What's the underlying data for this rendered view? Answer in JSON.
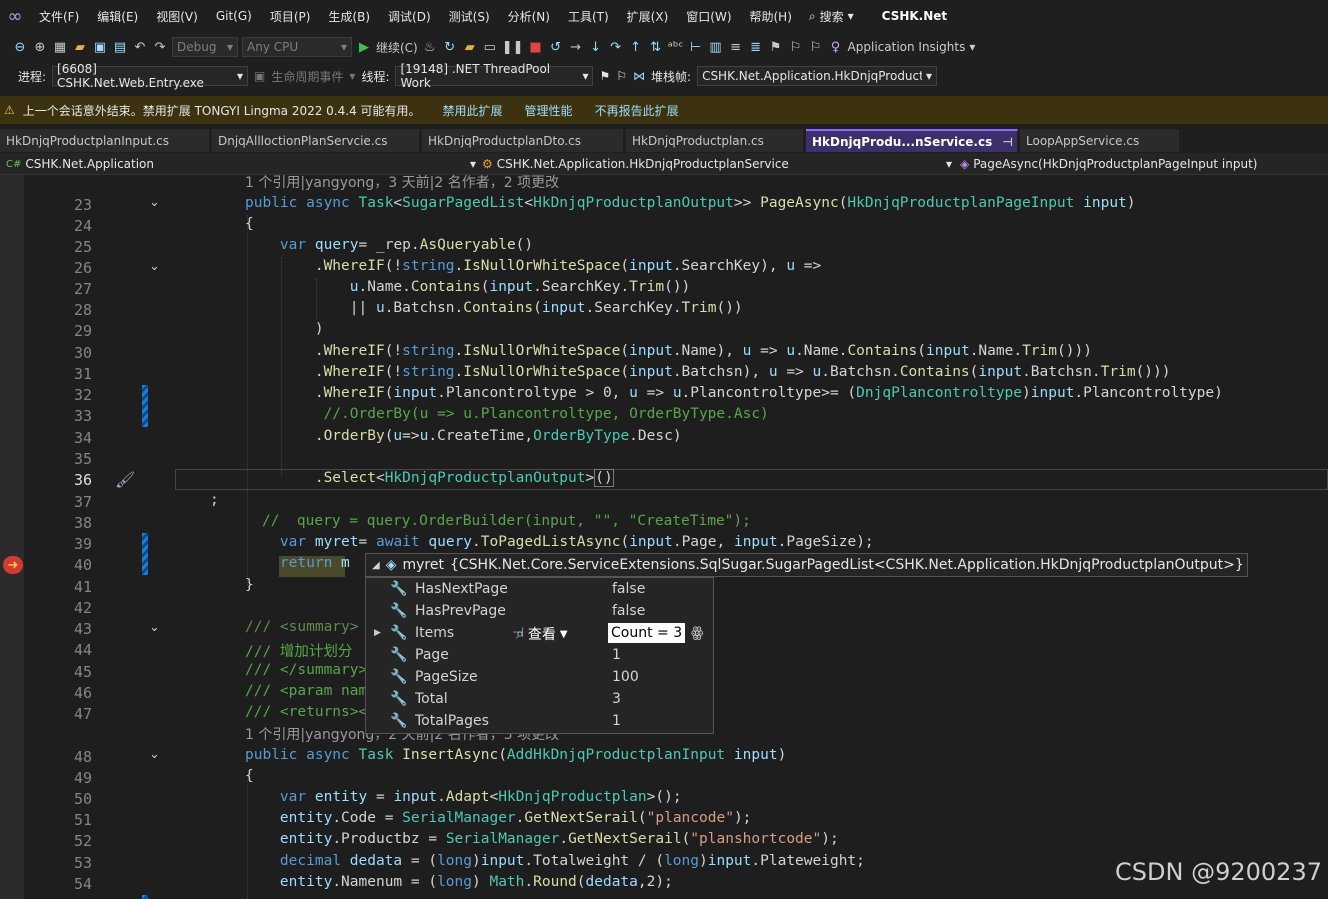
{
  "menu": {
    "items": [
      "文件(F)",
      "编辑(E)",
      "视图(V)",
      "Git(G)",
      "项目(P)",
      "生成(B)",
      "调试(D)",
      "测试(S)",
      "分析(N)",
      "工具(T)",
      "扩展(X)",
      "窗口(W)",
      "帮助(H)"
    ],
    "search": "搜索",
    "app_name": "CSHK.Net"
  },
  "toolbar": {
    "config": "Debug",
    "platform": "Any CPU",
    "continue": "继续(C)",
    "insights": "Application Insights"
  },
  "toolbar2": {
    "process_label": "进程:",
    "process": "[6608] CSHK.Net.Web.Entry.exe",
    "lifecycle": "生命周期事件",
    "thread_label": "线程:",
    "thread": "[19148] .NET ThreadPool Work",
    "stack_label": "堆栈帧:",
    "stack": "CSHK.Net.Application.HkDnjqProductp"
  },
  "infobar": {
    "message": "上一个会话意外结束。禁用扩展 TONGYI Lingma 2022 0.4.4 可能有用。",
    "links": [
      "禁用此扩展",
      "管理性能",
      "不再报告此扩展"
    ]
  },
  "tabs": [
    "HkDnjqProductplanInput.cs",
    "DnjqAllloctionPlanServcie.cs",
    "HkDnjqProductplanDto.cs",
    "HkDnjqProductplan.cs",
    "HkDnjqProdu...nService.cs",
    "LoopAppService.cs"
  ],
  "nav": {
    "project": "CSHK.Net.Application",
    "class": "CSHK.Net.Application.HkDnjqProductplanService",
    "member": "PageAsync(HkDnjqProductplanPageInput input)"
  },
  "codelens": {
    "c1": "1 个引用|yangyong，3 天前|2 名作者，2 项更改",
    "c2": "1 个引用|yangyong，2 天前|2 名作者，3 项更改"
  },
  "line_numbers": [
    "23",
    "24",
    "25",
    "26",
    "27",
    "28",
    "29",
    "30",
    "31",
    "32",
    "33",
    "34",
    "35",
    "36",
    "37",
    "38",
    "39",
    "40",
    "41",
    "42",
    "43",
    "44",
    "45",
    "46",
    "47",
    "48",
    "49",
    "50",
    "51",
    "52",
    "53",
    "54"
  ],
  "datatip": {
    "var": "myret",
    "type": "{CSHK.Net.Core.ServiceExtensions.SqlSugar.SugarPagedList<CSHK.Net.Application.HkDnjqProductplanOutput>}",
    "view": "查看",
    "rows": [
      {
        "name": "HasNextPage",
        "value": "false"
      },
      {
        "name": "HasPrevPage",
        "value": "false"
      },
      {
        "name": "Items",
        "value": "Count = 3"
      },
      {
        "name": "Page",
        "value": "1"
      },
      {
        "name": "PageSize",
        "value": "100"
      },
      {
        "name": "Total",
        "value": "3"
      },
      {
        "name": "TotalPages",
        "value": "1"
      }
    ]
  },
  "watermark": "CSDN @9200237"
}
